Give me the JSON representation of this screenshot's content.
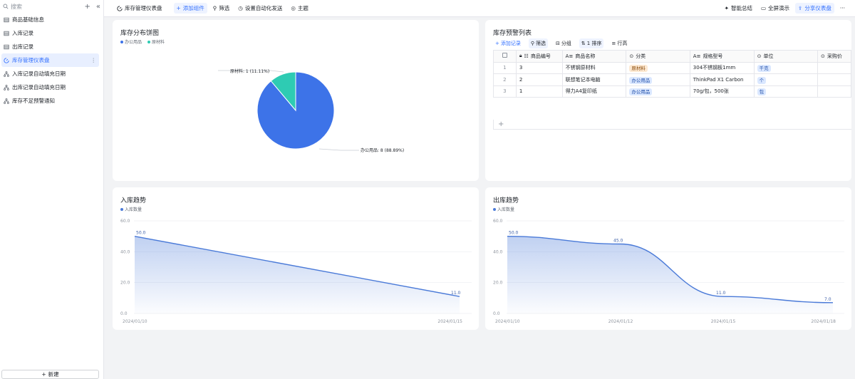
{
  "sidebar": {
    "search_placeholder": "搜索",
    "items": [
      {
        "label": "商品基础信息",
        "icon": "table-icon"
      },
      {
        "label": "入库记录",
        "icon": "table-icon"
      },
      {
        "label": "出库记录",
        "icon": "table-icon"
      },
      {
        "label": "库存管理仪表盘",
        "icon": "dashboard-icon",
        "active": true
      },
      {
        "label": "入库记录自动填充日期",
        "icon": "workflow-icon"
      },
      {
        "label": "出库记录自动填充日期",
        "icon": "workflow-icon"
      },
      {
        "label": "库存不足预警通知",
        "icon": "workflow-icon"
      }
    ],
    "new_label": "新建"
  },
  "toolbar": {
    "title": "库存管理仪表盘",
    "add_widget": "添加组件",
    "filter": "筛选",
    "auto_send": "设置自动化发送",
    "theme": "主题",
    "smart_summary": "智能总结",
    "fullscreen": "全屏演示",
    "share": "分享仪表盘"
  },
  "pie_card": {
    "title": "库存分布饼图"
  },
  "table_card": {
    "title": "库存预警列表",
    "toolbar": {
      "add": "添加记录",
      "filter": "筛选",
      "group": "分组",
      "sort": "1 排序",
      "row_height": "行高"
    },
    "columns": [
      "商品编号",
      "商品名称",
      "分类",
      "规格型号",
      "单位",
      "采购价"
    ],
    "rows": [
      {
        "n": "1",
        "id": "3",
        "name": "不锈钢原材料",
        "category": "原材料",
        "cat_color": "orange",
        "spec": "304不锈钢板1mm",
        "unit": "千克"
      },
      {
        "n": "2",
        "id": "2",
        "name": "联想笔记本电脑",
        "category": "办公用品",
        "cat_color": "blue",
        "spec": "ThinkPad X1 Carbon",
        "unit": "个"
      },
      {
        "n": "3",
        "id": "1",
        "name": "得力A4复印纸",
        "category": "办公用品",
        "cat_color": "blue",
        "spec": "70g/包，500张",
        "unit": "包"
      }
    ]
  },
  "in_card": {
    "title": "入库趋势"
  },
  "out_card": {
    "title": "出库趋势"
  },
  "colors": {
    "accent": "#3370ff",
    "pie_blue": "#3d73e8",
    "pie_teal": "#2ecbb3",
    "line": "#4a7ad8"
  },
  "chart_data": [
    {
      "type": "pie",
      "legend": [
        "办公用品",
        "原材料"
      ],
      "slices": [
        {
          "name": "办公用品",
          "value": 8,
          "label": "办公用品: 8 (88.89%)"
        },
        {
          "name": "原材料",
          "value": 1,
          "label": "原材料: 1 (11.11%)"
        }
      ]
    },
    {
      "type": "area",
      "series": [
        {
          "name": "入库数量",
          "values": [
            50.0,
            11.0
          ],
          "labels": [
            "50.0",
            "11.0"
          ]
        }
      ],
      "x": [
        "2024/01/10",
        "2024/01/15"
      ],
      "yticks": [
        "0.0",
        "20.0",
        "40.0",
        "60.0"
      ],
      "ylim": [
        0,
        60
      ]
    },
    {
      "type": "area",
      "series": [
        {
          "name": "入库数量",
          "values": [
            50.0,
            45.0,
            11.0,
            7.0
          ],
          "labels": [
            "50.0",
            "45.0",
            "11.0",
            "7.0"
          ]
        }
      ],
      "x": [
        "2024/01/10",
        "2024/01/12",
        "2024/01/15",
        "2024/01/18"
      ],
      "yticks": [
        "0.0",
        "20.0",
        "40.0",
        "60.0"
      ],
      "ylim": [
        0,
        60
      ]
    }
  ]
}
